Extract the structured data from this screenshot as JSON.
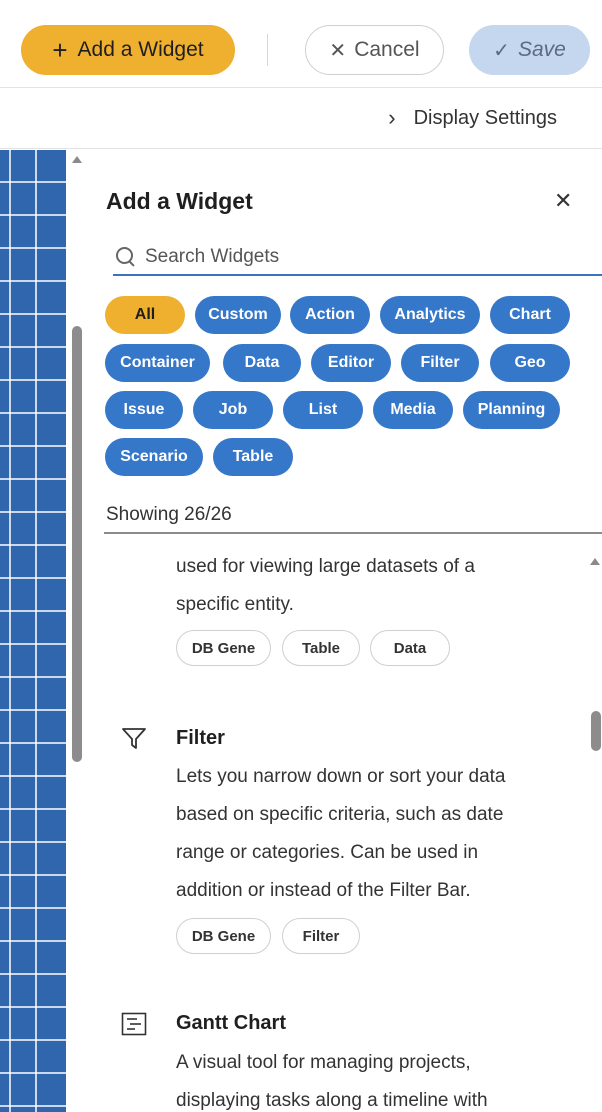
{
  "toolbar": {
    "add_widget_label": "Add a Widget",
    "cancel_label": "Cancel",
    "save_label": "Save"
  },
  "display_settings": {
    "label": "Display Settings"
  },
  "panel": {
    "title": "Add a Widget",
    "search_placeholder": "Search Widgets",
    "filters": [
      {
        "label": "All",
        "active": true
      },
      {
        "label": "Custom"
      },
      {
        "label": "Action"
      },
      {
        "label": "Analytics"
      },
      {
        "label": "Chart"
      },
      {
        "label": "Container"
      },
      {
        "label": "Data"
      },
      {
        "label": "Editor"
      },
      {
        "label": "Filter"
      },
      {
        "label": "Geo"
      },
      {
        "label": "Issue"
      },
      {
        "label": "Job"
      },
      {
        "label": "List"
      },
      {
        "label": "Media"
      },
      {
        "label": "Planning"
      },
      {
        "label": "Scenario"
      },
      {
        "label": "Table"
      }
    ],
    "showing": "Showing 26/26"
  },
  "widgets": [
    {
      "title": "",
      "lines": [
        "used for viewing large datasets of a",
        "specific entity."
      ],
      "tags": [
        "DB Gene",
        "Table",
        "Data"
      ]
    },
    {
      "title": "Filter",
      "icon": "filter-icon",
      "lines": [
        "Lets you narrow down or sort your data",
        "based on specific criteria, such as date",
        "range or categories. Can be used in",
        "addition or instead of the Filter Bar."
      ],
      "tags": [
        "DB Gene",
        "Filter"
      ]
    },
    {
      "title": "Gantt Chart",
      "icon": "gantt-chart-icon",
      "lines": [
        "A visual tool for managing projects,",
        "displaying tasks along a timeline with"
      ]
    }
  ],
  "colors": {
    "accent": "#efaf2f",
    "chip_blue": "#3577c9",
    "save_bg": "#c4d7ef",
    "grid_blue": "#2f66ad"
  }
}
